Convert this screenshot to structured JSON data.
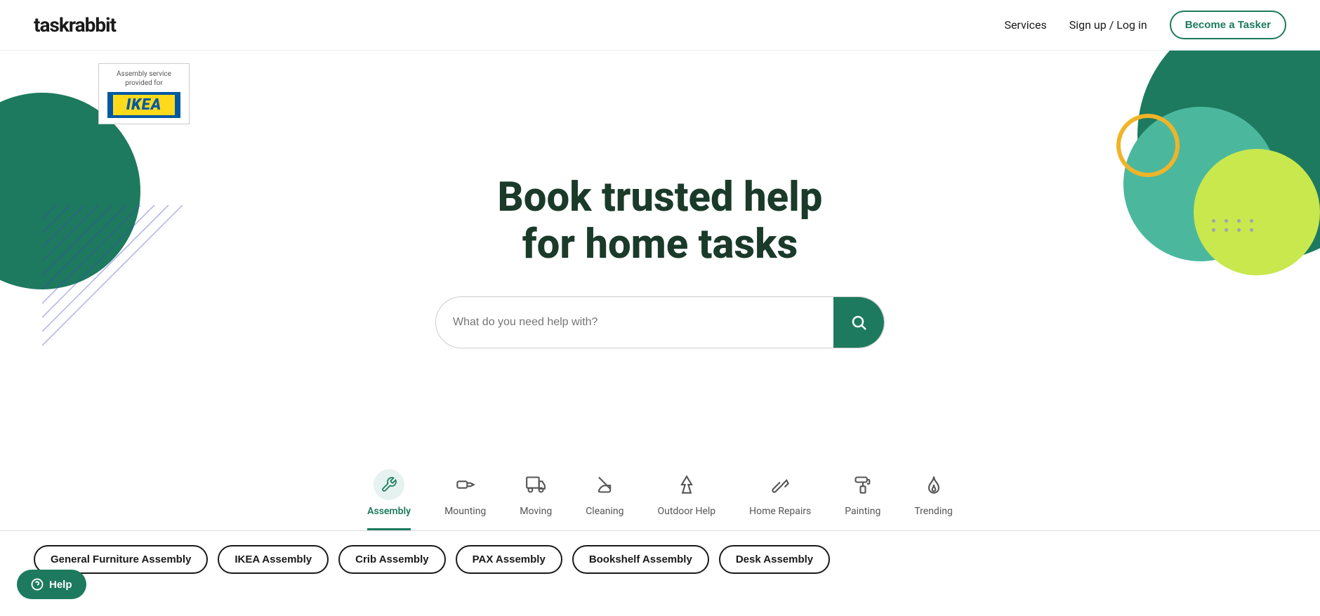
{
  "navbar": {
    "logo": "taskrabbit",
    "links": [
      {
        "label": "Services",
        "id": "services-link"
      },
      {
        "label": "Sign up / Log in",
        "id": "signup-login-link"
      }
    ],
    "cta_button": "Become a Tasker"
  },
  "ikea_badge": {
    "line1": "Assembly service",
    "line2": "provided for",
    "logo_text": "IKEA"
  },
  "hero": {
    "title_line1": "Book trusted help",
    "title_line2": "for home tasks",
    "search_placeholder": "What do you need help with?"
  },
  "categories": [
    {
      "id": "assembly",
      "label": "Assembly",
      "active": true,
      "icon": "tools-icon"
    },
    {
      "id": "mounting",
      "label": "Mounting",
      "active": false,
      "icon": "drill-icon"
    },
    {
      "id": "moving",
      "label": "Moving",
      "active": false,
      "icon": "truck-icon"
    },
    {
      "id": "cleaning",
      "label": "Cleaning",
      "active": false,
      "icon": "broom-icon"
    },
    {
      "id": "outdoor-help",
      "label": "Outdoor Help",
      "active": false,
      "icon": "tree-icon"
    },
    {
      "id": "home-repairs",
      "label": "Home Repairs",
      "active": false,
      "icon": "hammer-icon"
    },
    {
      "id": "painting",
      "label": "Painting",
      "active": false,
      "icon": "paintroller-icon"
    },
    {
      "id": "trending",
      "label": "Trending",
      "active": false,
      "icon": "fire-icon"
    }
  ],
  "subcategories": [
    "General Furniture Assembly",
    "IKEA Assembly",
    "Crib Assembly",
    "PAX Assembly",
    "Bookshelf Assembly",
    "Desk Assembly"
  ],
  "help_button": "Help",
  "dots_count": 8
}
